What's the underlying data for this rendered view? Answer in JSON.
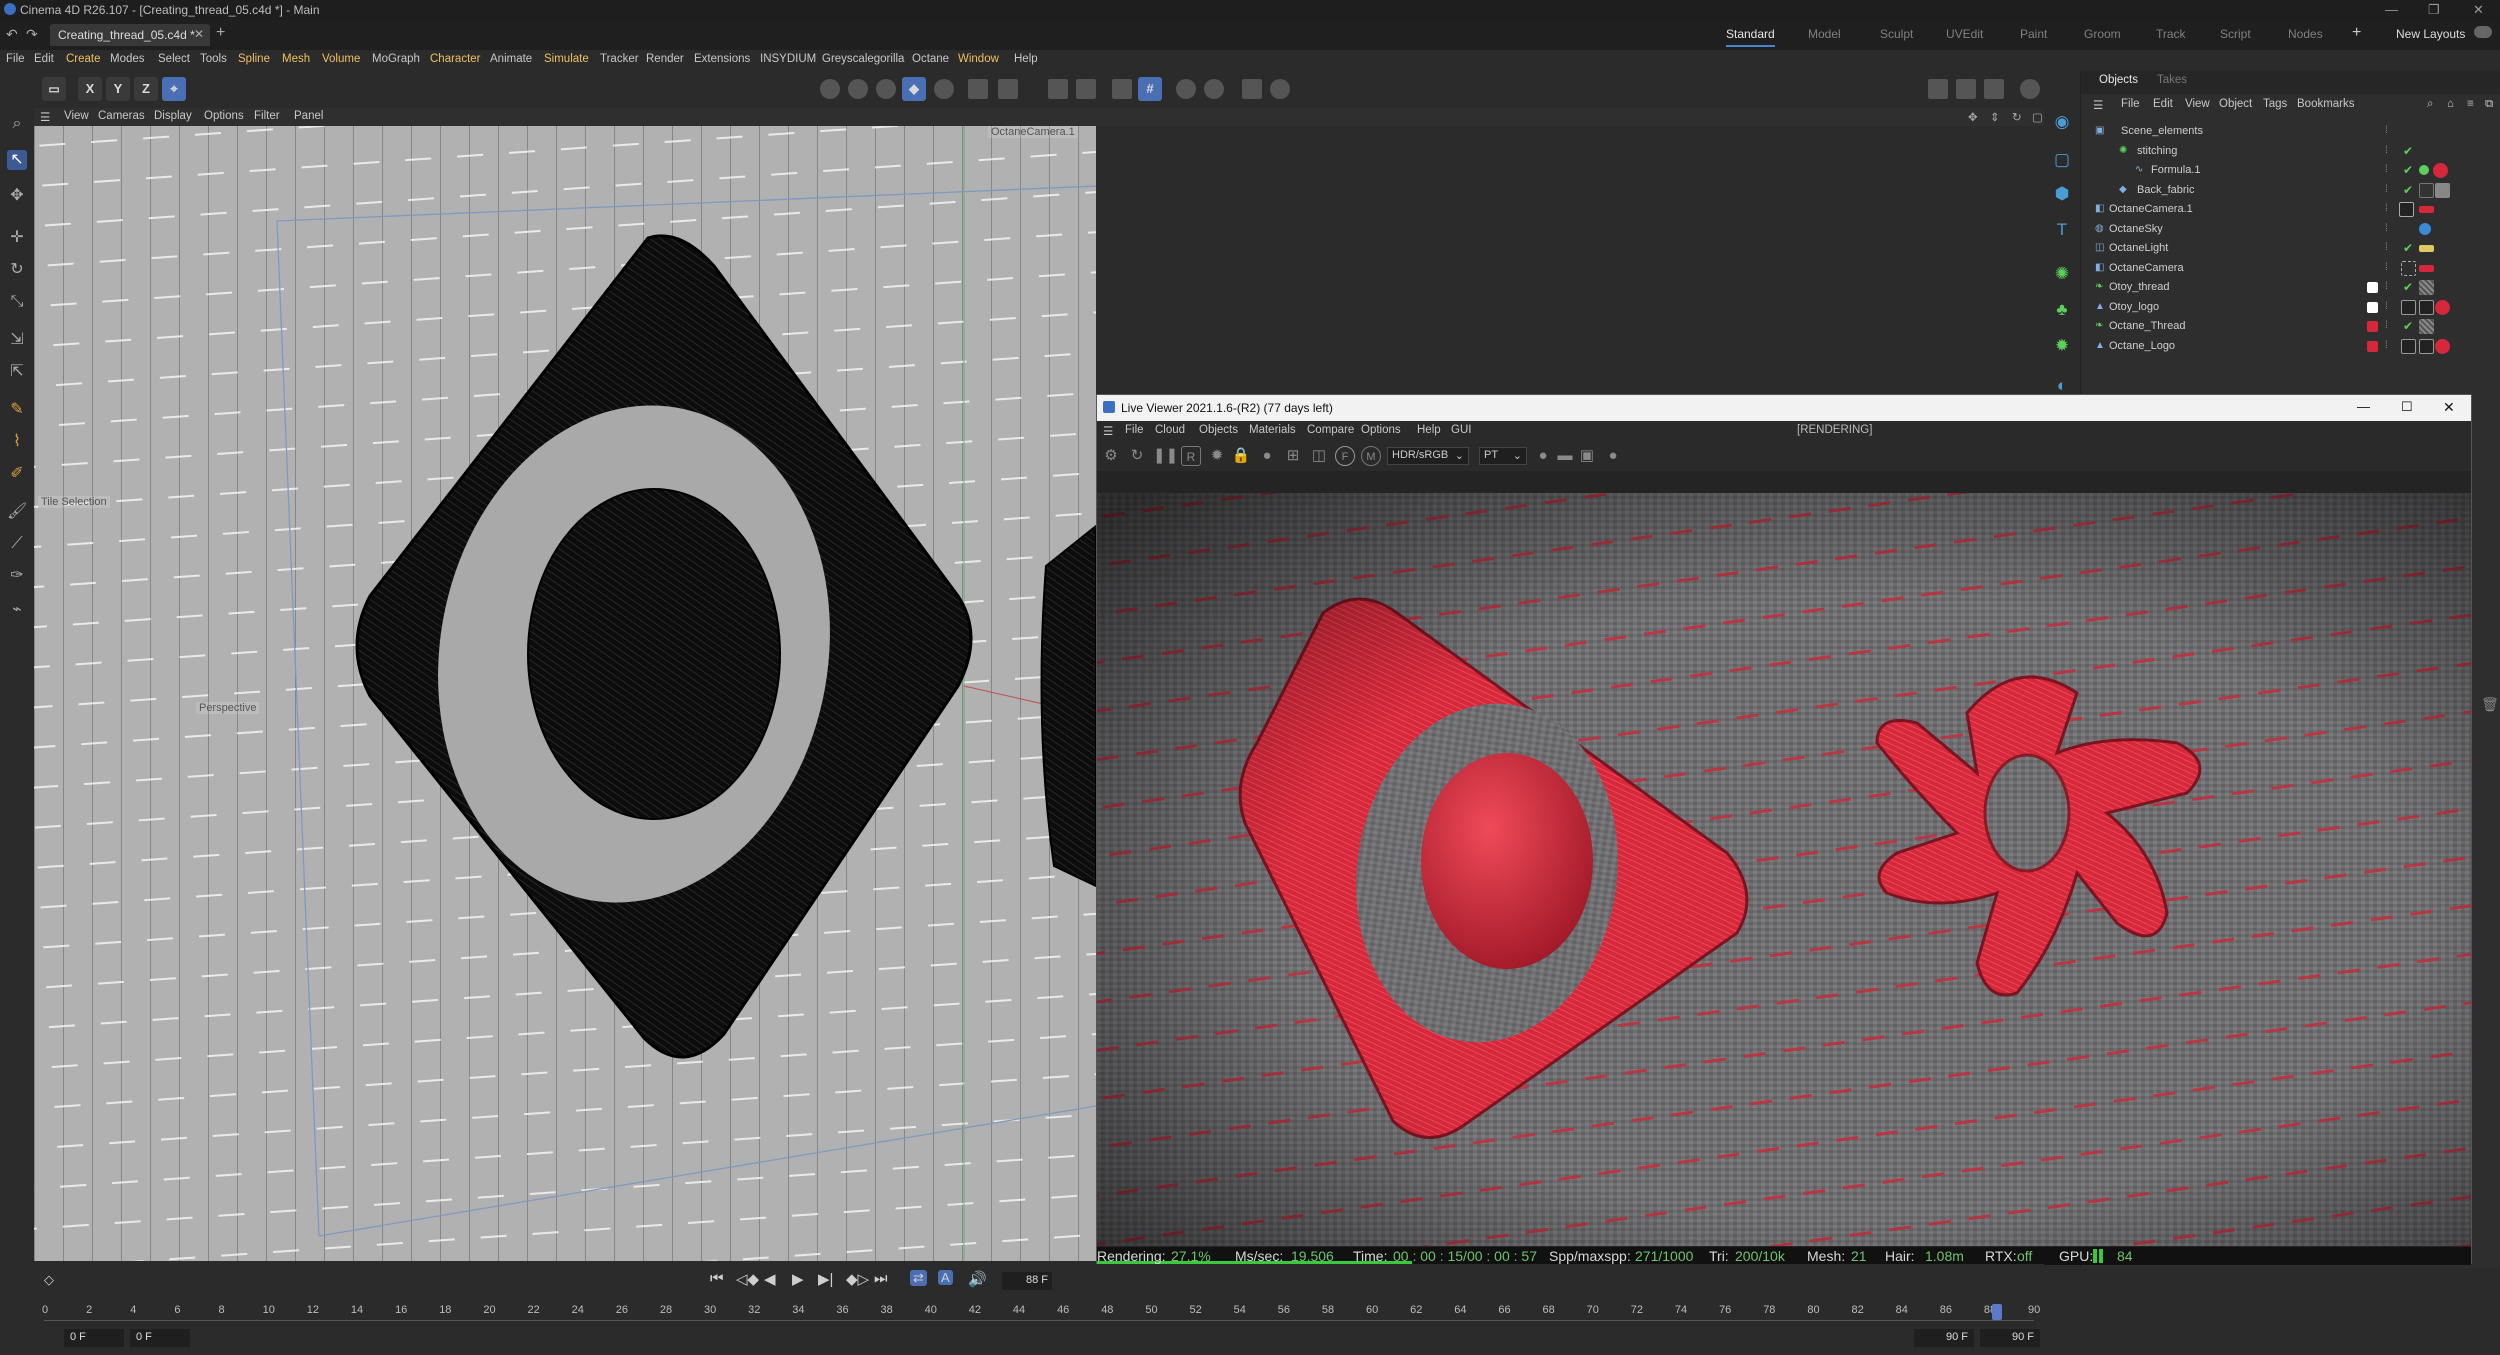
{
  "window": {
    "title": "Cinema 4D R26.107 - [Creating_thread_05.c4d *] - Main",
    "doc_tab": "Creating_thread_05.c4d *"
  },
  "layouts": [
    "Standard",
    "Model",
    "Sculpt",
    "UVEdit",
    "Paint",
    "Groom",
    "Track",
    "Script",
    "Nodes"
  ],
  "new_layouts": "New Layouts",
  "menus": [
    "File",
    "Edit",
    "Create",
    "Modes",
    "Select",
    "Tools",
    "Spline",
    "Mesh",
    "Volume",
    "MoGraph",
    "Character",
    "Animate",
    "Simulate",
    "Tracker",
    "Render",
    "Extensions",
    "INSYDIUM",
    "Greyscalegorilla",
    "Octane",
    "Window",
    "Help"
  ],
  "toolbar": {
    "axis_x": "X",
    "axis_y": "Y",
    "axis_z": "Z"
  },
  "viewport": {
    "menu": [
      "View",
      "Cameras",
      "Display",
      "Options",
      "Filter",
      "Panel"
    ],
    "camera_label": "OctaneCamera.1",
    "tile_label": "Tile Selection",
    "projection_label": "Perspective"
  },
  "live_viewer": {
    "title": "Live Viewer 2021.1.6-(R2) (77 days left)",
    "menu": [
      "File",
      "Cloud",
      "Objects",
      "Materials",
      "Compare",
      "Options",
      "Help",
      "GUI"
    ],
    "state": "[RENDERING]",
    "color_space": "HDR/sRGB",
    "kernel": "PT",
    "status": {
      "rendering_label": "Rendering:",
      "rendering_value": "27.1%",
      "mssec_label": "Ms/sec:",
      "mssec_value": "19.506",
      "time_label": "Time:",
      "time_value": "00 : 00 : 15/00 : 00 : 57",
      "spp_label": "Spp/maxspp:",
      "spp_value": "271/1000",
      "tri_label": "Tri:",
      "tri_value": "200/10k",
      "mesh_label": "Mesh:",
      "mesh_value": "21",
      "hair_label": "Hair:",
      "hair_value": "1.08m",
      "rtx_label": "RTX:",
      "rtx_value": "off",
      "gpu_label": "GPU:",
      "gpu_value": "84"
    },
    "progress": 0.271
  },
  "objects_panel": {
    "tabs": [
      "Objects",
      "Takes"
    ],
    "menu": [
      "File",
      "Edit",
      "View",
      "Object",
      "Tags",
      "Bookmarks"
    ],
    "items": [
      {
        "name": "Scene_elements",
        "indent": 0,
        "check": ""
      },
      {
        "name": "stitching",
        "indent": 1,
        "check": "✔"
      },
      {
        "name": "Formula.1",
        "indent": 2,
        "check": "✔"
      },
      {
        "name": "Back_fabric",
        "indent": 1,
        "check": "✔"
      },
      {
        "name": "OctaneCamera.1",
        "indent": 0,
        "check": ""
      },
      {
        "name": "OctaneSky",
        "indent": 0,
        "check": ""
      },
      {
        "name": "OctaneLight",
        "indent": 0,
        "check": "✔"
      },
      {
        "name": "OctaneCamera",
        "indent": 0,
        "check": ""
      },
      {
        "name": "Otoy_thread",
        "indent": 0,
        "check": "✔"
      },
      {
        "name": "Otoy_logo",
        "indent": 0,
        "check": ""
      },
      {
        "name": "Octane_Thread",
        "indent": 0,
        "check": "✔"
      },
      {
        "name": "Octane_Logo",
        "indent": 0,
        "check": ""
      }
    ]
  },
  "timeline": {
    "current_frame": "88 F",
    "start_field": "0 F",
    "start_field2": "0 F",
    "end_field": "90 F",
    "end_field2": "90 F",
    "ticks": [
      "0",
      "2",
      "4",
      "6",
      "8",
      "10",
      "12",
      "14",
      "16",
      "18",
      "20",
      "22",
      "24",
      "26",
      "28",
      "30",
      "32",
      "34",
      "36",
      "38",
      "40",
      "42",
      "44",
      "46",
      "48",
      "50",
      "52",
      "54",
      "56",
      "58",
      "60",
      "62",
      "64",
      "66",
      "68",
      "70",
      "72",
      "74",
      "76",
      "78",
      "80",
      "82",
      "84",
      "86",
      "88",
      "90"
    ]
  },
  "colors": {
    "accent": "#4a82d4",
    "thread_red": "#d6283a",
    "viewport_bg": "#a9a9a9",
    "status_green": "#6fc36f"
  }
}
